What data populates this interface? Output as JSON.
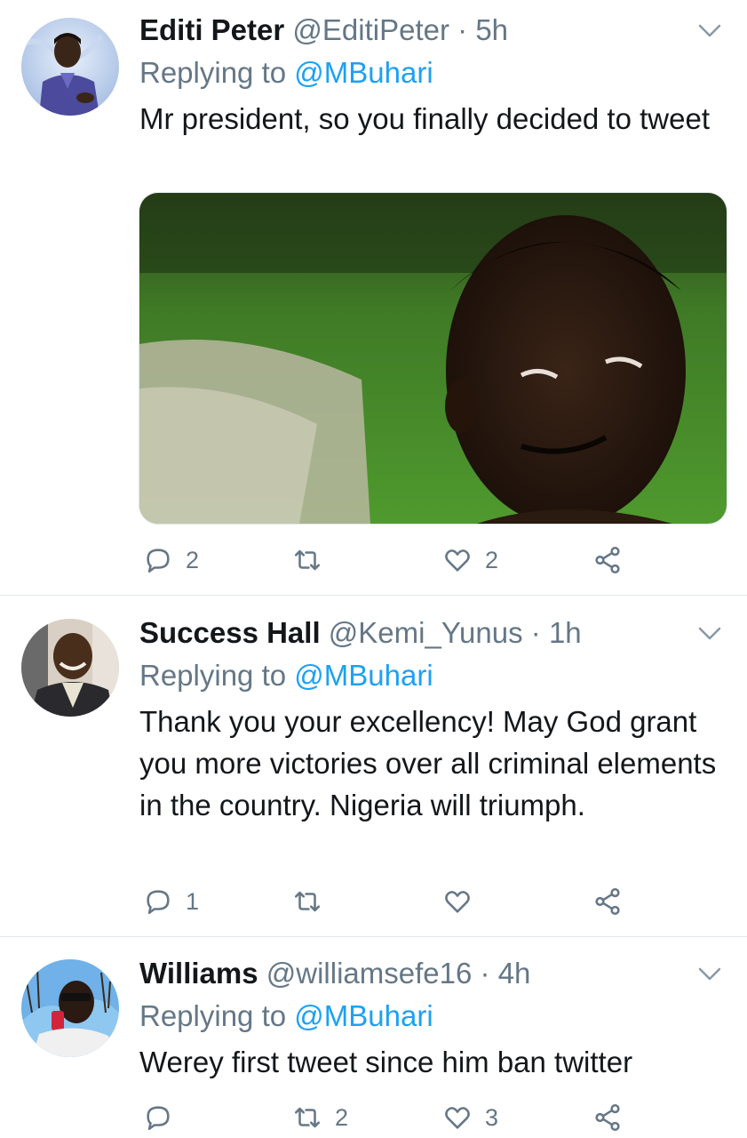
{
  "tweets": [
    {
      "name": "Editi Peter",
      "handle": "@EditiPeter",
      "separator": "·",
      "time": "5h",
      "replying_label": "Replying to",
      "replying_to": "@MBuhari",
      "text": "Mr president, so you finally decided to tweet",
      "has_media": true,
      "reply_count": "2",
      "retweet_count": "",
      "like_count": "2"
    },
    {
      "name": "Success Hall",
      "handle": "@Kemi_Yunus",
      "separator": "·",
      "time": "1h",
      "replying_label": "Replying to",
      "replying_to": "@MBuhari",
      "text": "Thank you your excellency! May God grant you more victories over all criminal elements in the country. Nigeria will triumph.",
      "has_media": false,
      "reply_count": "1",
      "retweet_count": "",
      "like_count": ""
    },
    {
      "name": "Williams",
      "handle": "@williamsefe16",
      "separator": "·",
      "time": "4h",
      "replying_label": "Replying to",
      "replying_to": "@MBuhari",
      "text": "Werey first tweet since him ban twitter",
      "has_media": false,
      "reply_count": "",
      "retweet_count": "2",
      "like_count": "3"
    }
  ],
  "icons": {
    "reply": "reply-bubble-icon",
    "retweet": "retweet-icon",
    "like": "heart-icon",
    "share": "share-icon",
    "menu": "chevron-down-icon"
  },
  "colors": {
    "name": "#14171a",
    "secondary": "#657786",
    "link": "#1da1f2",
    "divider": "#e1e8ed"
  }
}
